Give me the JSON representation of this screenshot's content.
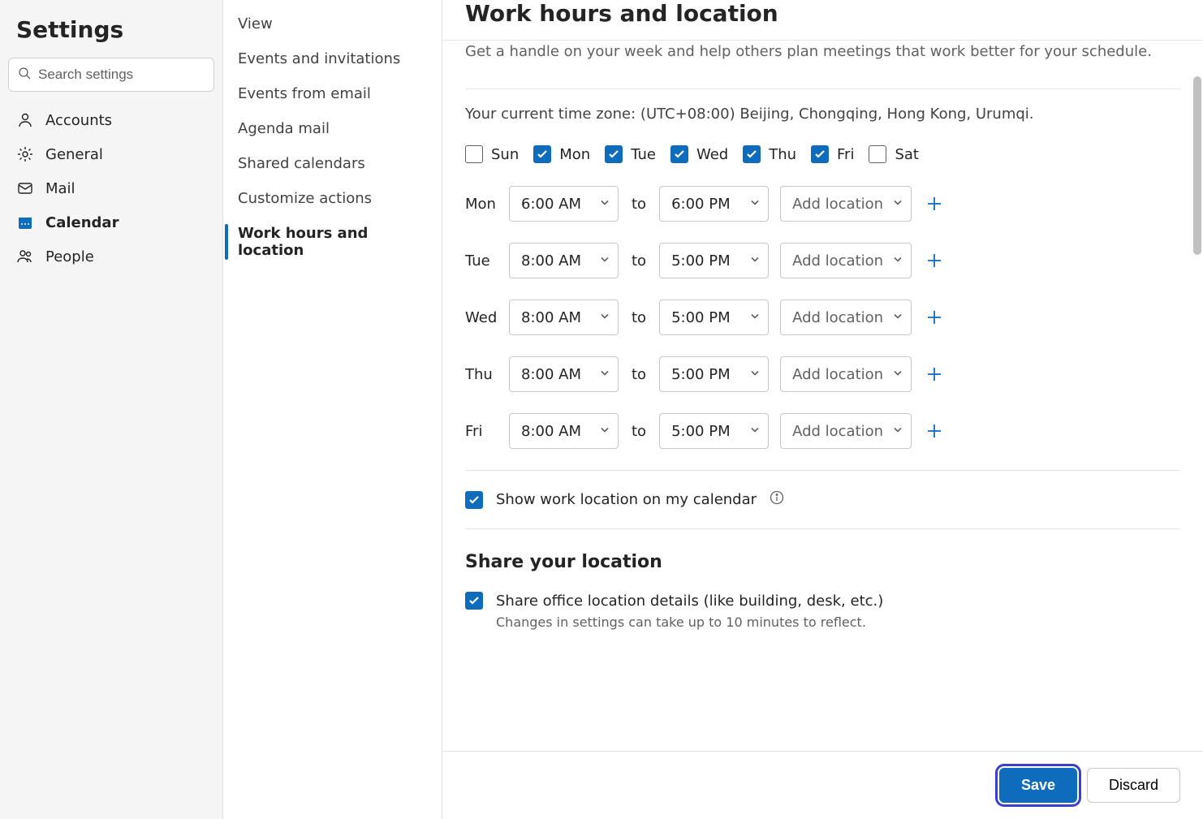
{
  "sidebar": {
    "title": "Settings",
    "search_placeholder": "Search settings",
    "items": [
      {
        "label": "Accounts",
        "icon": "person"
      },
      {
        "label": "General",
        "icon": "gear"
      },
      {
        "label": "Mail",
        "icon": "mail"
      },
      {
        "label": "Calendar",
        "icon": "calendar",
        "active": true
      },
      {
        "label": "People",
        "icon": "people"
      }
    ]
  },
  "submenu": {
    "items": [
      {
        "label": "View"
      },
      {
        "label": "Events and invitations"
      },
      {
        "label": "Events from email"
      },
      {
        "label": "Agenda mail"
      },
      {
        "label": "Shared calendars"
      },
      {
        "label": "Customize actions"
      },
      {
        "label": "Work hours and location",
        "active": true
      }
    ]
  },
  "main": {
    "title": "Work hours and location",
    "intro": "Get a handle on your week and help others plan meetings that work better for your schedule.",
    "timezone_label": "Your current time zone: (UTC+08:00) Beijing, Chongqing, Hong Kong, Urumqi.",
    "days": [
      {
        "short": "Sun",
        "checked": false
      },
      {
        "short": "Mon",
        "checked": true
      },
      {
        "short": "Tue",
        "checked": true
      },
      {
        "short": "Wed",
        "checked": true
      },
      {
        "short": "Thu",
        "checked": true
      },
      {
        "short": "Fri",
        "checked": true
      },
      {
        "short": "Sat",
        "checked": false
      }
    ],
    "to_label": "to",
    "location_placeholder": "Add location",
    "schedule": [
      {
        "day": "Mon",
        "start": "6:00 AM",
        "end": "6:00 PM"
      },
      {
        "day": "Tue",
        "start": "8:00 AM",
        "end": "5:00 PM"
      },
      {
        "day": "Wed",
        "start": "8:00 AM",
        "end": "5:00 PM"
      },
      {
        "day": "Thu",
        "start": "8:00 AM",
        "end": "5:00 PM"
      },
      {
        "day": "Fri",
        "start": "8:00 AM",
        "end": "5:00 PM"
      }
    ],
    "show_location_label": "Show work location on my calendar",
    "show_location_checked": true,
    "share_section_title": "Share your location",
    "share_office_label": "Share office location details (like building, desk, etc.)",
    "share_office_checked": true,
    "share_hint": "Changes in settings can take up to 10 minutes to reflect."
  },
  "footer": {
    "save": "Save",
    "discard": "Discard"
  }
}
